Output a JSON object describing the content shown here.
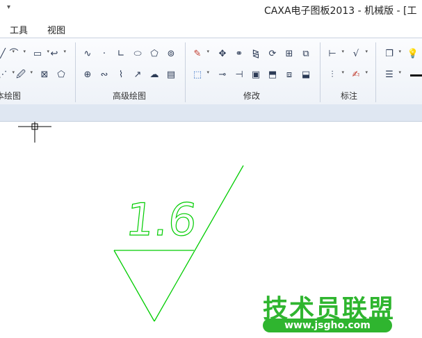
{
  "titlebar": {
    "quick_access": "▾",
    "title": "CAXA电子图板2013 - 机械版 - [工"
  },
  "menu": {
    "items": [
      "工具",
      "视图"
    ]
  },
  "ribbon": {
    "groups": [
      {
        "label": "本绘图"
      },
      {
        "label": "高级绘图"
      },
      {
        "label": "修改"
      },
      {
        "label": "标注"
      }
    ]
  },
  "canvas": {
    "roughness_value": "1.6",
    "line_color": "#00cc00"
  },
  "watermark": {
    "text": "技术员联盟",
    "url": "www.jsgho.com"
  }
}
